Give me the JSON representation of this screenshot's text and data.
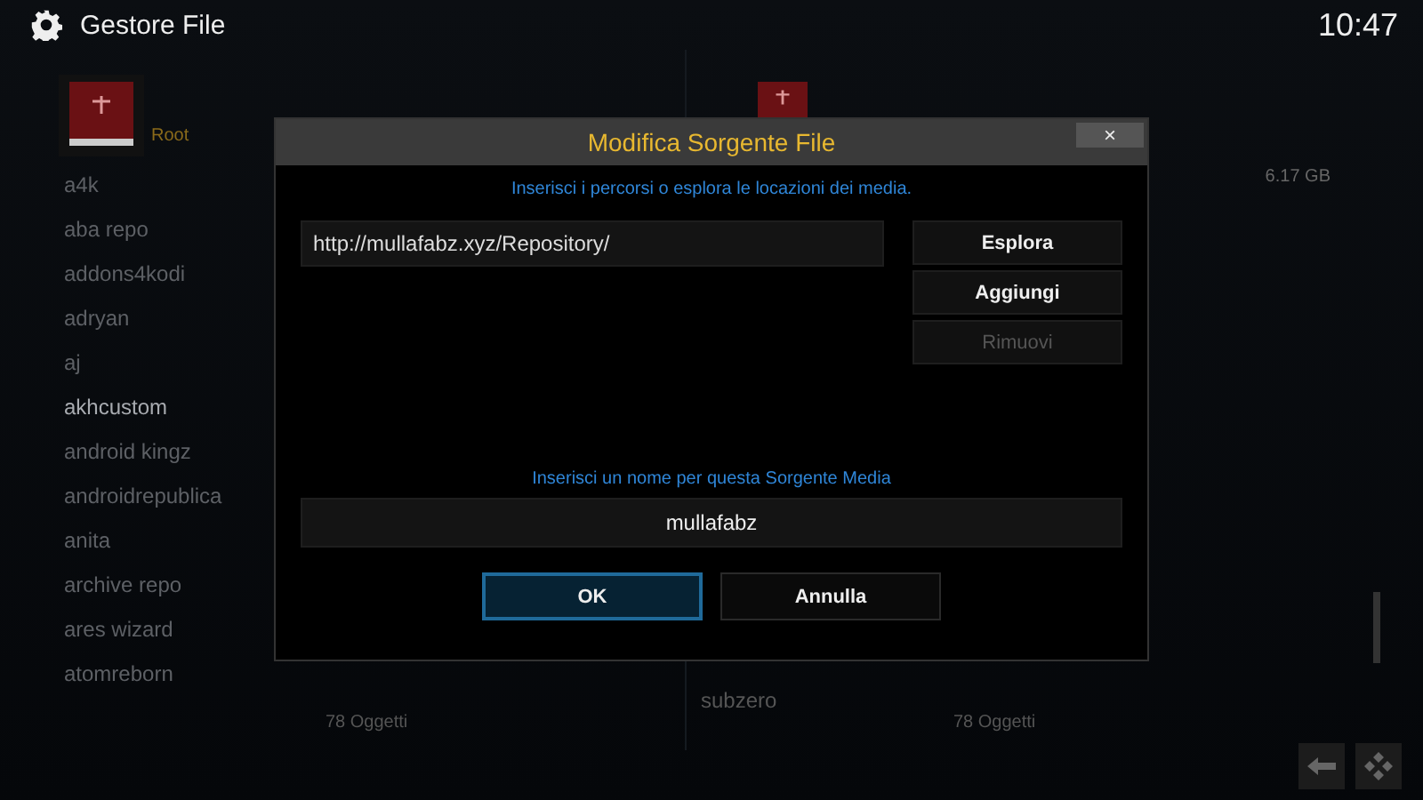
{
  "header": {
    "title": "Gestore File",
    "clock": "10:47"
  },
  "left_panel": {
    "root_label": "Root",
    "items": [
      {
        "label": "a4k",
        "selected": false
      },
      {
        "label": "aba repo",
        "selected": false
      },
      {
        "label": "addons4kodi",
        "selected": false
      },
      {
        "label": "adryan",
        "selected": false
      },
      {
        "label": "aj",
        "selected": false
      },
      {
        "label": "akhcustom",
        "selected": true
      },
      {
        "label": "android kingz",
        "selected": false
      },
      {
        "label": "androidrepublica",
        "selected": false
      },
      {
        "label": "anita",
        "selected": false
      },
      {
        "label": "archive repo",
        "selected": false
      },
      {
        "label": "ares wizard",
        "selected": false
      },
      {
        "label": "atomreborn",
        "selected": false
      }
    ],
    "count": "78 Oggetti"
  },
  "right_panel": {
    "size": "6.17 GB",
    "last_item": "subzero",
    "count": "78 Oggetti"
  },
  "dialog": {
    "title": "Modifica Sorgente File",
    "close": "×",
    "hint": "Inserisci i percorsi o esplora le locazioni dei media.",
    "path": "http://mullafabz.xyz/Repository/",
    "side_buttons": [
      {
        "label": "Esplora",
        "disabled": false
      },
      {
        "label": "Aggiungi",
        "disabled": false
      },
      {
        "label": "Rimuovi",
        "disabled": true
      }
    ],
    "name_hint": "Inserisci un nome per questa Sorgente Media",
    "name_value": "mullafabz",
    "buttons": [
      {
        "label": "OK",
        "selected": true
      },
      {
        "label": "Annulla",
        "selected": false
      }
    ]
  }
}
